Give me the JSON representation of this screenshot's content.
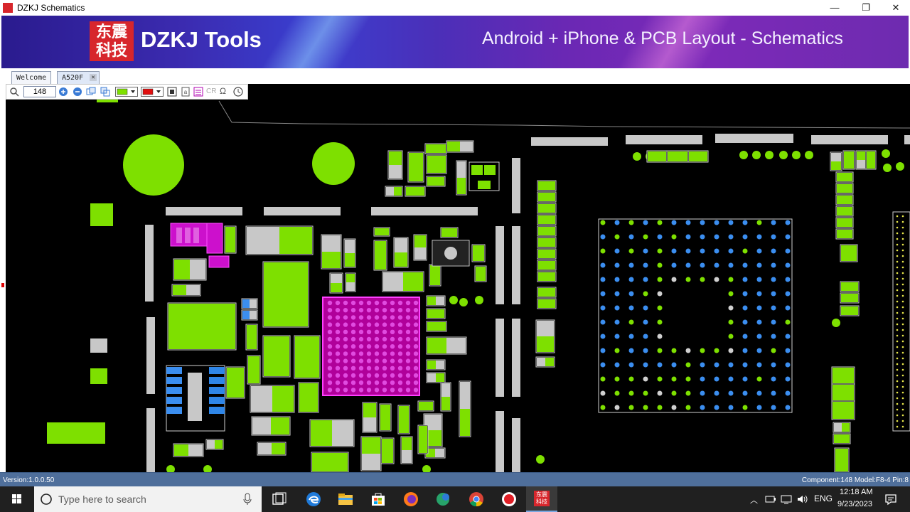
{
  "window": {
    "title": "DZKJ Schematics",
    "minimize_glyph": "—",
    "maximize_glyph": "❐",
    "close_glyph": "✕"
  },
  "banner": {
    "logo_text": "东震科技",
    "brand": "DZKJ Tools",
    "tagline": "Android + iPhone & PCB Layout - Schematics"
  },
  "tabs": [
    {
      "label": "Welcome"
    },
    {
      "label": "A520F"
    }
  ],
  "toolbar": {
    "zoom_value": "148",
    "icons": [
      "search-icon",
      "zoom-in-icon",
      "zoom-out-icon",
      "fit-icon",
      "restore-icon",
      "color-picker-green",
      "color-picker-red",
      "layer-icon",
      "doc-icon",
      "list-icon",
      "cr-icon",
      "ohm-icon",
      "clock-icon"
    ],
    "cr_label": "CR",
    "ohm_label": "Ω"
  },
  "statusbar": {
    "version": "Version:1.0.0.50",
    "component": "Component:148 Model:F8-4 Pin:8"
  },
  "taskbar": {
    "search_placeholder": "Type here to search",
    "language": "ENG",
    "time": "12:18 AM",
    "date": "9/23/2023"
  },
  "colors": {
    "pad_green": "#7ee000",
    "pad_gray": "#c8c8c8",
    "pad_magenta": "#cc10cc",
    "ball_blue": "#3b8ef0",
    "pcb_background": "#000000"
  }
}
